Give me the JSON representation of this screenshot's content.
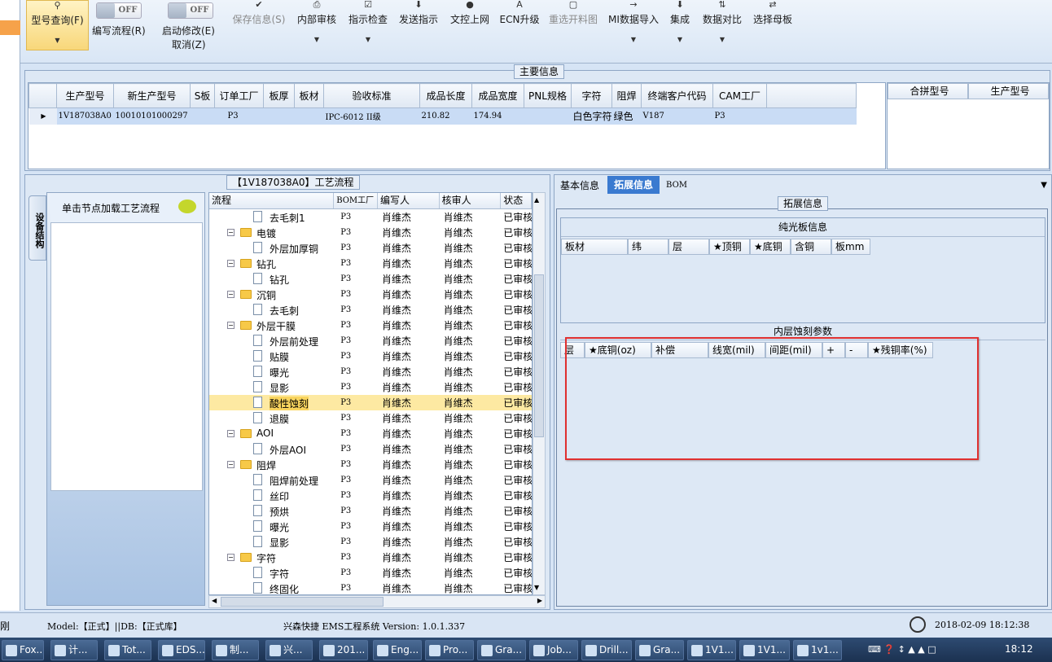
{
  "ribbon": {
    "model_query": "型号查询(F)",
    "toggle_off": "OFF",
    "write_flow": "编写流程(R)",
    "start_modify": "启动修改(E)",
    "cancel": "取消(Z)",
    "save_info": "保存信息(S)",
    "internal_review": "内部审核",
    "indicator_check": "指示检查",
    "send_instructions": "发送指示",
    "cam_online": "文控上网",
    "ecn_upgrade": "ECN升级",
    "reselect_drawing": "重选开料图",
    "mi_import": "MI数据导入",
    "integrate": "集成",
    "data_compare": "数据对比",
    "select_master": "选择母板"
  },
  "main_info": {
    "title": "主要信息",
    "columns": [
      "生产型号",
      "新生产型号",
      "S板",
      "订单工厂",
      "板厚",
      "板材",
      "验收标准",
      "成品长度",
      "成品宽度",
      "PNL规格",
      "字符",
      "阻焊",
      "终端客户代码",
      "CAM工厂"
    ],
    "row": [
      "1V187038A0",
      "10010101000297",
      "",
      "P3",
      "",
      "",
      "IPC-6012 II级",
      "210.82",
      "174.94",
      "",
      "白色字符",
      "绿色",
      "V187",
      "P3"
    ],
    "merge_columns": [
      "合拼型号",
      "生产型号"
    ]
  },
  "process": {
    "title": "【1V187038A0】工艺流程",
    "side_tab": "设备结构",
    "node_hint": "单击节点加载工艺流程",
    "columns": [
      "流程",
      "BOM工厂",
      "编写人",
      "核审人",
      "状态"
    ],
    "rows": [
      {
        "name": "去毛刺1",
        "level": 2,
        "type": "doc",
        "bom": "P3",
        "writer": "肖维杰",
        "reviewer": "肖维杰",
        "status": "已审核"
      },
      {
        "name": "电镀",
        "level": 1,
        "type": "folder",
        "bom": "P3",
        "writer": "肖维杰",
        "reviewer": "肖维杰",
        "status": "已审核"
      },
      {
        "name": "外层加厚铜",
        "level": 2,
        "type": "doc",
        "bom": "P3",
        "writer": "肖维杰",
        "reviewer": "肖维杰",
        "status": "已审核"
      },
      {
        "name": "钻孔",
        "level": 1,
        "type": "folder",
        "bom": "P3",
        "writer": "肖维杰",
        "reviewer": "肖维杰",
        "status": "已审核"
      },
      {
        "name": "钻孔",
        "level": 2,
        "type": "doc",
        "bom": "P3",
        "writer": "肖维杰",
        "reviewer": "肖维杰",
        "status": "已审核"
      },
      {
        "name": "沉铜",
        "level": 1,
        "type": "folder",
        "bom": "P3",
        "writer": "肖维杰",
        "reviewer": "肖维杰",
        "status": "已审核"
      },
      {
        "name": "去毛刺",
        "level": 2,
        "type": "doc",
        "bom": "P3",
        "writer": "肖维杰",
        "reviewer": "肖维杰",
        "status": "已审核"
      },
      {
        "name": "外层干膜",
        "level": 1,
        "type": "folder",
        "bom": "P3",
        "writer": "肖维杰",
        "reviewer": "肖维杰",
        "status": "已审核"
      },
      {
        "name": "外层前处理",
        "level": 2,
        "type": "doc",
        "bom": "P3",
        "writer": "肖维杰",
        "reviewer": "肖维杰",
        "status": "已审核"
      },
      {
        "name": "贴膜",
        "level": 2,
        "type": "doc",
        "bom": "P3",
        "writer": "肖维杰",
        "reviewer": "肖维杰",
        "status": "已审核"
      },
      {
        "name": "曝光",
        "level": 2,
        "type": "doc",
        "bom": "P3",
        "writer": "肖维杰",
        "reviewer": "肖维杰",
        "status": "已审核"
      },
      {
        "name": "显影",
        "level": 2,
        "type": "doc",
        "bom": "P3",
        "writer": "肖维杰",
        "reviewer": "肖维杰",
        "status": "已审核"
      },
      {
        "name": "酸性蚀刻",
        "level": 2,
        "type": "doc",
        "bom": "P3",
        "writer": "肖维杰",
        "reviewer": "肖维杰",
        "status": "已审核",
        "selected": true
      },
      {
        "name": "退膜",
        "level": 2,
        "type": "doc",
        "bom": "P3",
        "writer": "肖维杰",
        "reviewer": "肖维杰",
        "status": "已审核"
      },
      {
        "name": "AOI",
        "level": 1,
        "type": "folder",
        "bom": "P3",
        "writer": "肖维杰",
        "reviewer": "肖维杰",
        "status": "已审核"
      },
      {
        "name": "外层AOI",
        "level": 2,
        "type": "doc",
        "bom": "P3",
        "writer": "肖维杰",
        "reviewer": "肖维杰",
        "status": "已审核"
      },
      {
        "name": "阻焊",
        "level": 1,
        "type": "folder",
        "bom": "P3",
        "writer": "肖维杰",
        "reviewer": "肖维杰",
        "status": "已审核"
      },
      {
        "name": "阻焊前处理",
        "level": 2,
        "type": "doc",
        "bom": "P3",
        "writer": "肖维杰",
        "reviewer": "肖维杰",
        "status": "已审核"
      },
      {
        "name": "丝印",
        "level": 2,
        "type": "doc",
        "bom": "P3",
        "writer": "肖维杰",
        "reviewer": "肖维杰",
        "status": "已审核"
      },
      {
        "name": "预烘",
        "level": 2,
        "type": "doc",
        "bom": "P3",
        "writer": "肖维杰",
        "reviewer": "肖维杰",
        "status": "已审核"
      },
      {
        "name": "曝光",
        "level": 2,
        "type": "doc",
        "bom": "P3",
        "writer": "肖维杰",
        "reviewer": "肖维杰",
        "status": "已审核"
      },
      {
        "name": "显影",
        "level": 2,
        "type": "doc",
        "bom": "P3",
        "writer": "肖维杰",
        "reviewer": "肖维杰",
        "status": "已审核"
      },
      {
        "name": "字符",
        "level": 1,
        "type": "folder",
        "bom": "P3",
        "writer": "肖维杰",
        "reviewer": "肖维杰",
        "status": "已审核"
      },
      {
        "name": "字符",
        "level": 2,
        "type": "doc",
        "bom": "P3",
        "writer": "肖维杰",
        "reviewer": "肖维杰",
        "status": "已审核"
      },
      {
        "name": "终固化",
        "level": 2,
        "type": "doc",
        "bom": "P3",
        "writer": "肖维杰",
        "reviewer": "肖维杰",
        "status": "已审核"
      }
    ]
  },
  "right": {
    "tabs": [
      "基本信息",
      "拓展信息",
      "BOM"
    ],
    "active_tab": 1,
    "section_title": "拓展信息",
    "pure_title": "纯光板信息",
    "pure_columns": [
      "板材",
      "纬",
      "层",
      "★顶铜",
      "★底铜",
      "含铜",
      "板mm"
    ],
    "inner_title": "内层蚀刻参数",
    "inner_columns": [
      "层",
      "★底铜(oz)",
      "补偿",
      "线宽(mil)",
      "间距(mil)",
      "+",
      "-",
      "★残铜率(%)"
    ]
  },
  "status": {
    "left_char": "刚",
    "model": "Model:【正式】||DB:【正式库】",
    "system": "兴森快捷 EMS工程系统 Version: 1.0.1.337",
    "datetime": "2018-02-09 18:12:38"
  },
  "taskbar": {
    "items": [
      "Fox...",
      "计...",
      "Tot...",
      "EDS...",
      "制...",
      "兴...",
      "201...",
      "Eng...",
      "Pro...",
      "Gra...",
      "Job...",
      "Drill...",
      "Gra...",
      "1V1...",
      "1V1...",
      "1v1..."
    ],
    "clock": "18:12"
  },
  "colors": {
    "highlight": "#fde9a2",
    "selected_row": "#c9dcf5",
    "red_box": "#e03030"
  }
}
